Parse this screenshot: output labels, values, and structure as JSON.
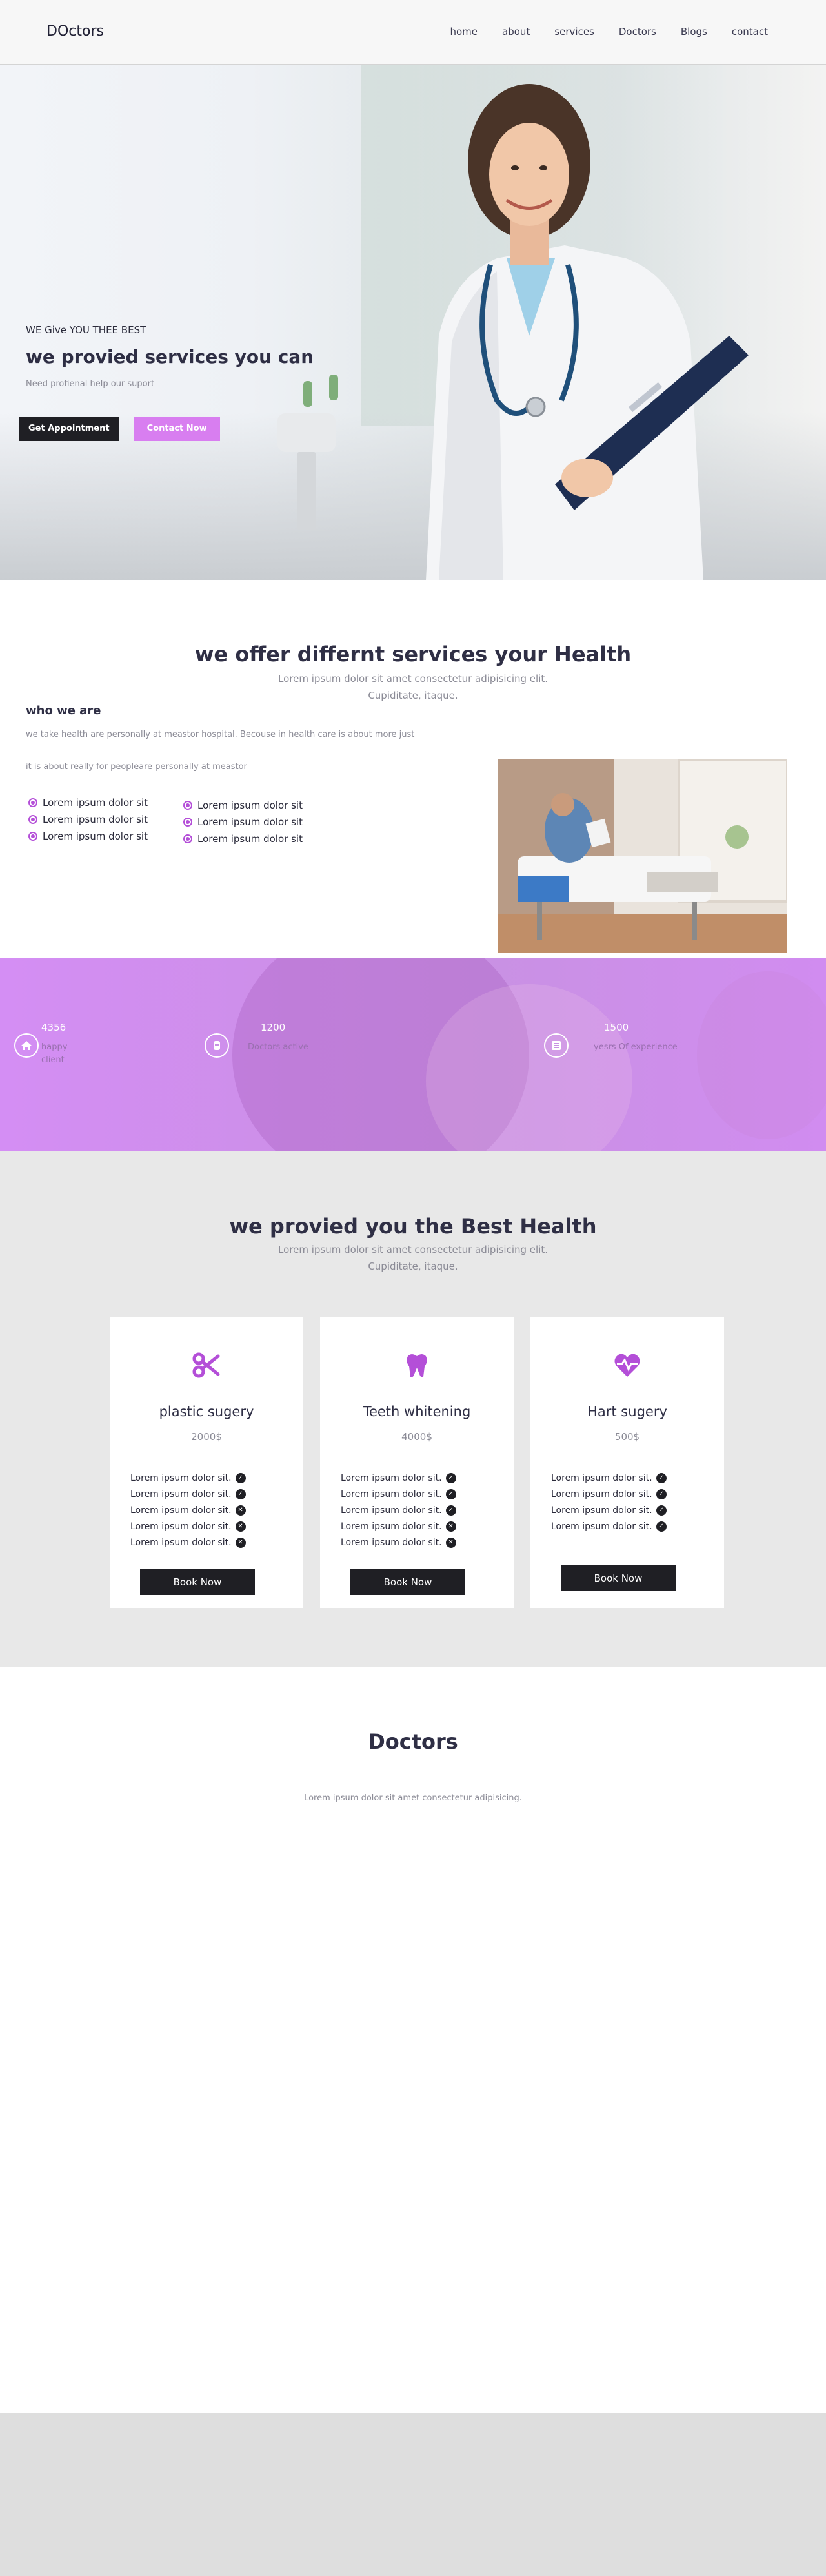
{
  "nav": {
    "logo": "DOctors",
    "items": [
      "home",
      "about",
      "services",
      "Doctors",
      "Blogs",
      "contact"
    ]
  },
  "hero": {
    "eyebrow": "WE Give YOU THEE BEST",
    "title": "we provied services you can",
    "subtitle": "Need profienal help our suport",
    "btn_appointment": "Get Appointment",
    "btn_contact": "Contact Now"
  },
  "offer": {
    "title": "we offer differnt services your Health",
    "subtitle_line1": "Lorem ipsum dolor sit amet consectetur adipisicing elit.",
    "subtitle_line2": "Cupiditate, itaque.",
    "who_title": "who we are",
    "para1": "we take health are personally at meastor hospital. Becouse in health care is about more just",
    "para2": "it is about really for peopleare personally at meastor",
    "list_left": [
      "Lorem ipsum dolor sit",
      "Lorem ipsum dolor sit",
      "Lorem ipsum dolor sit"
    ],
    "list_right": [
      "Lorem ipsum dolor sit",
      "Lorem ipsum dolor sit",
      "Lorem ipsum dolor sit"
    ]
  },
  "stats": [
    {
      "icon": "home-icon",
      "number": "4356",
      "label": "happy client"
    },
    {
      "icon": "users-icon",
      "number": "1200",
      "label": "Doctors active"
    },
    {
      "icon": "list-icon",
      "number": "1500",
      "label": "yesrs Of experience"
    }
  ],
  "pricing": {
    "title": "we provied you the Best Health",
    "subtitle_line1": "Lorem ipsum dolor sit amet consectetur adipisicing elit.",
    "subtitle_line2": "Cupiditate, itaque.",
    "cards": [
      {
        "icon": "scissors-icon",
        "title": "plastic sugery",
        "price": "2000$",
        "features": [
          "Lorem ipsum dolor sit.",
          "Lorem ipsum dolor sit.",
          "Lorem ipsum dolor sit.",
          "Lorem ipsum dolor sit.",
          "Lorem ipsum dolor sit."
        ],
        "button": "Book Now"
      },
      {
        "icon": "tooth-icon",
        "title": "Teeth whitening",
        "price": "4000$",
        "features": [
          "Lorem ipsum dolor sit.",
          "Lorem ipsum dolor sit.",
          "Lorem ipsum dolor sit.",
          "Lorem ipsum dolor sit.",
          "Lorem ipsum dolor sit."
        ],
        "button": "Book Now"
      },
      {
        "icon": "heartbeat-icon",
        "title": "Hart sugery",
        "price": "500$",
        "features": [
          "Lorem ipsum dolor sit.",
          "Lorem ipsum dolor sit.",
          "Lorem ipsum dolor sit.",
          "Lorem ipsum dolor sit."
        ],
        "button": "Book Now"
      }
    ]
  },
  "doctors": {
    "title": "Doctors",
    "subtitle": "Lorem ipsum dolor sit amet consectetur adipisicing."
  },
  "colors": {
    "accent": "#d87ef0",
    "accent_dark": "#b44fd8",
    "dark": "#1f1f24",
    "section_gray": "#e8e8e8"
  }
}
